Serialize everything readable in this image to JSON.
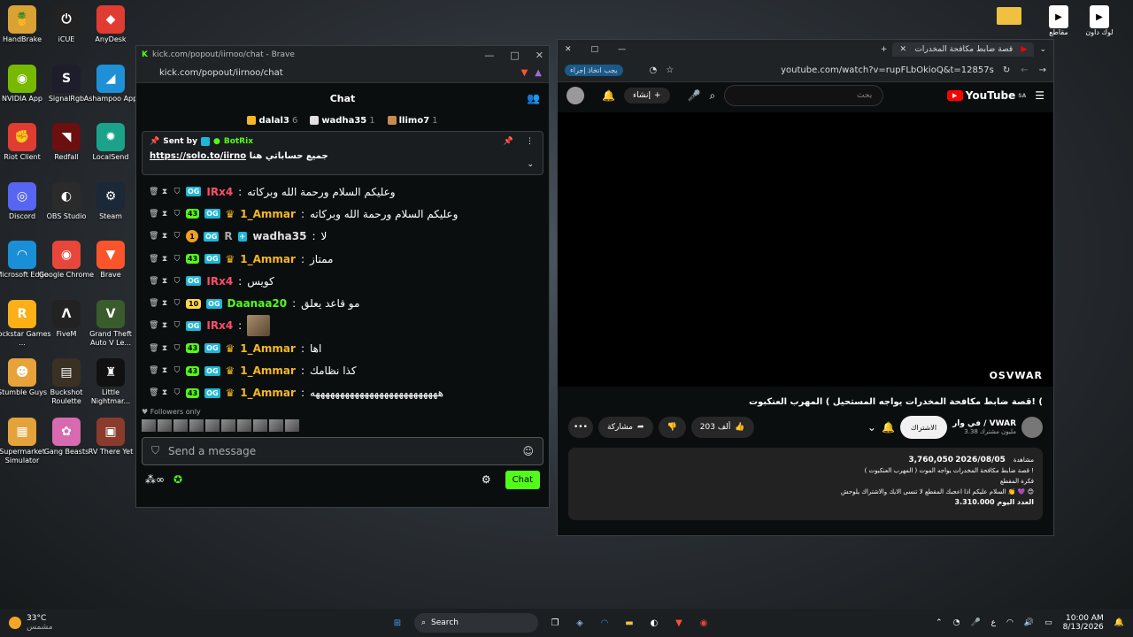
{
  "desktop_icons": [
    {
      "label": "HandBrake",
      "glyph": "🍍",
      "color": "#d9a233"
    },
    {
      "label": "iCUE",
      "glyph": "⏻",
      "color": "#222"
    },
    {
      "label": "AnyDesk",
      "glyph": "◆",
      "color": "#e03c31"
    },
    {
      "label": "NVIDIA App",
      "glyph": "◉",
      "color": "#76b900"
    },
    {
      "label": "SignalRgb",
      "glyph": "S",
      "color": "#1d1d2b"
    },
    {
      "label": "Ashampoo App",
      "glyph": "◢",
      "color": "#1e90d8"
    },
    {
      "label": "Riot Client",
      "glyph": "✊",
      "color": "#e03c31"
    },
    {
      "label": "Redfall",
      "glyph": "◥",
      "color": "#6b0f0f"
    },
    {
      "label": "LocalSend",
      "glyph": "✹",
      "color": "#1aa38a"
    },
    {
      "label": "Discord",
      "glyph": "◎",
      "color": "#5865f2"
    },
    {
      "label": "OBS Studio",
      "glyph": "◐",
      "color": "#2b2b2b"
    },
    {
      "label": "Steam",
      "glyph": "⚙",
      "color": "#1b2838"
    },
    {
      "label": "Microsoft Edge",
      "glyph": "◠",
      "color": "#1a8fd8"
    },
    {
      "label": "Google Chrome",
      "glyph": "◉",
      "color": "#e8463a"
    },
    {
      "label": "Brave",
      "glyph": "▼",
      "color": "#fb542b"
    },
    {
      "label": "Rockstar Games ...",
      "glyph": "R",
      "color": "#fcaf17"
    },
    {
      "label": "FiveM",
      "glyph": "Λ",
      "color": "#222"
    },
    {
      "label": "Grand Theft Auto V Le...",
      "glyph": "V",
      "color": "#3a5b2c"
    },
    {
      "label": "Stumble Guys",
      "glyph": "☻",
      "color": "#e8a23a"
    },
    {
      "label": "Buckshot Roulette",
      "glyph": "▤",
      "color": "#3b3024"
    },
    {
      "label": "Little Nightmar...",
      "glyph": "♜",
      "color": "#111"
    },
    {
      "label": "Supermarket Simulator",
      "glyph": "▦",
      "color": "#e3a23a"
    },
    {
      "label": "Gang Beasts",
      "glyph": "✿",
      "color": "#d86ab0"
    },
    {
      "label": "RV There Yet",
      "glyph": "▣",
      "color": "#8b3b2c"
    }
  ],
  "top_right_icons": [
    {
      "label": "",
      "glyph": "▬"
    },
    {
      "label": "مقاطع",
      "glyph": "▶"
    },
    {
      "label": "لوك داون",
      "glyph": "▶"
    }
  ],
  "kick": {
    "title": "kick.com/popout/iirnoo/chat - Brave",
    "url": "kick.com/popout/iirnoo/chat",
    "header": "Chat",
    "leaders": [
      {
        "name": "dalal3",
        "count": "6",
        "color": "#f5b820"
      },
      {
        "name": "wadha35",
        "count": "1",
        "color": "#e0e0e0"
      },
      {
        "name": "llimo7",
        "count": "1",
        "color": "#c88a50"
      }
    ],
    "pinned": {
      "sent_by": "Sent by",
      "bot": "BotRix",
      "link": "https://solo.to/iirno",
      "text": "جميع حساباتي هنا"
    },
    "messages": [
      {
        "sub": "",
        "extra": "",
        "user": "IRx4",
        "user_color": "#ff4d6d",
        "text": "وعليكم السلام ورحمة الله وبركاته",
        "emote": false
      },
      {
        "sub": "43",
        "extra": "",
        "user": "1_Ammar",
        "user_color": "#f5b820",
        "text": "وعليكم السلام ورحمة الله وبركاته",
        "emote": false
      },
      {
        "sub": "1",
        "extra": "R",
        "user": "wadha35",
        "user_color": "#e0e0e0",
        "text": "لا",
        "emote": false
      },
      {
        "sub": "43",
        "extra": "",
        "user": "1_Ammar",
        "user_color": "#f5b820",
        "text": "ممتاز",
        "emote": false
      },
      {
        "sub": "",
        "extra": "",
        "user": "IRx4",
        "user_color": "#ff4d6d",
        "text": "كويس",
        "emote": false
      },
      {
        "sub": "10",
        "extra": "",
        "user": "Daanaa20",
        "user_color": "#53fc18",
        "text": "مو قاعد يعلق",
        "emote": false
      },
      {
        "sub": "",
        "extra": "",
        "user": "IRx4",
        "user_color": "#ff4d6d",
        "text": "",
        "emote": true
      },
      {
        "sub": "43",
        "extra": "",
        "user": "1_Ammar",
        "user_color": "#f5b820",
        "text": "اها",
        "emote": false
      },
      {
        "sub": "43",
        "extra": "",
        "user": "1_Ammar",
        "user_color": "#f5b820",
        "text": "كذا نظامك",
        "emote": false
      },
      {
        "sub": "43",
        "extra": "",
        "user": "1_Ammar",
        "user_color": "#f5b820",
        "text": "ههههههههههههههههههههههههههه",
        "emote": false
      }
    ],
    "followers_only": "Followers only",
    "composer_placeholder": "Send a message",
    "chat_button": "Chat"
  },
  "youtube": {
    "tab_title": "قصة ضابط مكافحة المخدرات",
    "url": "youtube.com/watch?v=rupFLbOkioQ&t=12857s",
    "action_needed": "يجب اتخاذ إجراء",
    "create": "إنشاء",
    "search_placeholder": "بحث",
    "logo": "YouTube",
    "region": "SA",
    "watermark": "OSVWAR",
    "video_title": "قصة ضابط مكافحة المخدرات يواجه المستحيل ) المهرب العنكبوت! (",
    "channel": "في وار / VWAR",
    "subscribers": "3.38 مليون مشترك",
    "subscribe": "الاشتراك",
    "likes": "203 ألف",
    "share": "مشاركة",
    "views": "3,760,050",
    "views_label": "مشاهدة",
    "date": "2026/08/05",
    "desc_lines": [
      "قصة ضابط مكافحة المخدرات يواجه الموت ( المهرب العنكبوت ) !",
      "فكرة المقطع",
      "السلام عليكم اذا اعجبك المقطع لا تنسى الايك والاشتراك يلوحش 👏 💜 😊",
      "العدد اليوم 3.310.000"
    ]
  },
  "taskbar": {
    "weather_temp": "33°C",
    "weather_text": "مشمس",
    "search": "Search",
    "time": "10:00 AM",
    "date": "8/13/2026",
    "lang": "ع"
  }
}
